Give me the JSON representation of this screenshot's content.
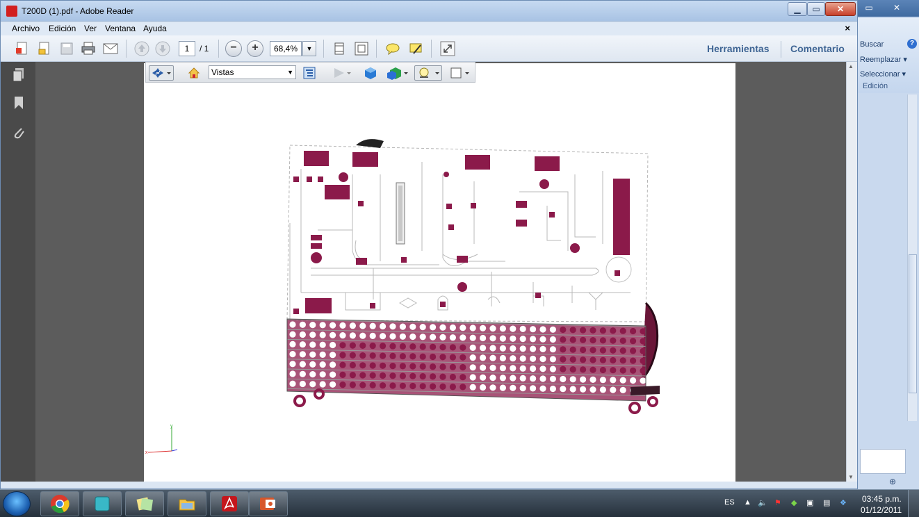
{
  "window": {
    "title": "T200D (1).pdf - Adobe Reader",
    "min_label": "▁",
    "max_label": "▭",
    "close_label": "✕"
  },
  "menu": {
    "items": [
      "Archivo",
      "Edición",
      "Ver",
      "Ventana",
      "Ayuda"
    ],
    "close": "×"
  },
  "toolbar": {
    "page_current": "1",
    "page_total": "/ 1",
    "zoom": "68,4%",
    "tools_label": "Herramientas",
    "comment_label": "Comentario"
  },
  "viewer3d": {
    "views_label": "Vistas"
  },
  "background_app": {
    "buscar": "Buscar",
    "reemplazar": "Reemplazar ▾",
    "seleccionar": "Seleccionar ▾",
    "group_label": "Edición",
    "help": "?",
    "restore": "▭",
    "close": "✕"
  },
  "taskbar": {
    "language": "ES",
    "time": "03:45 p.m.",
    "date": "01/12/2011"
  },
  "colors": {
    "model_magenta": "#8b1a4a",
    "reader_link": "#3f6594"
  }
}
